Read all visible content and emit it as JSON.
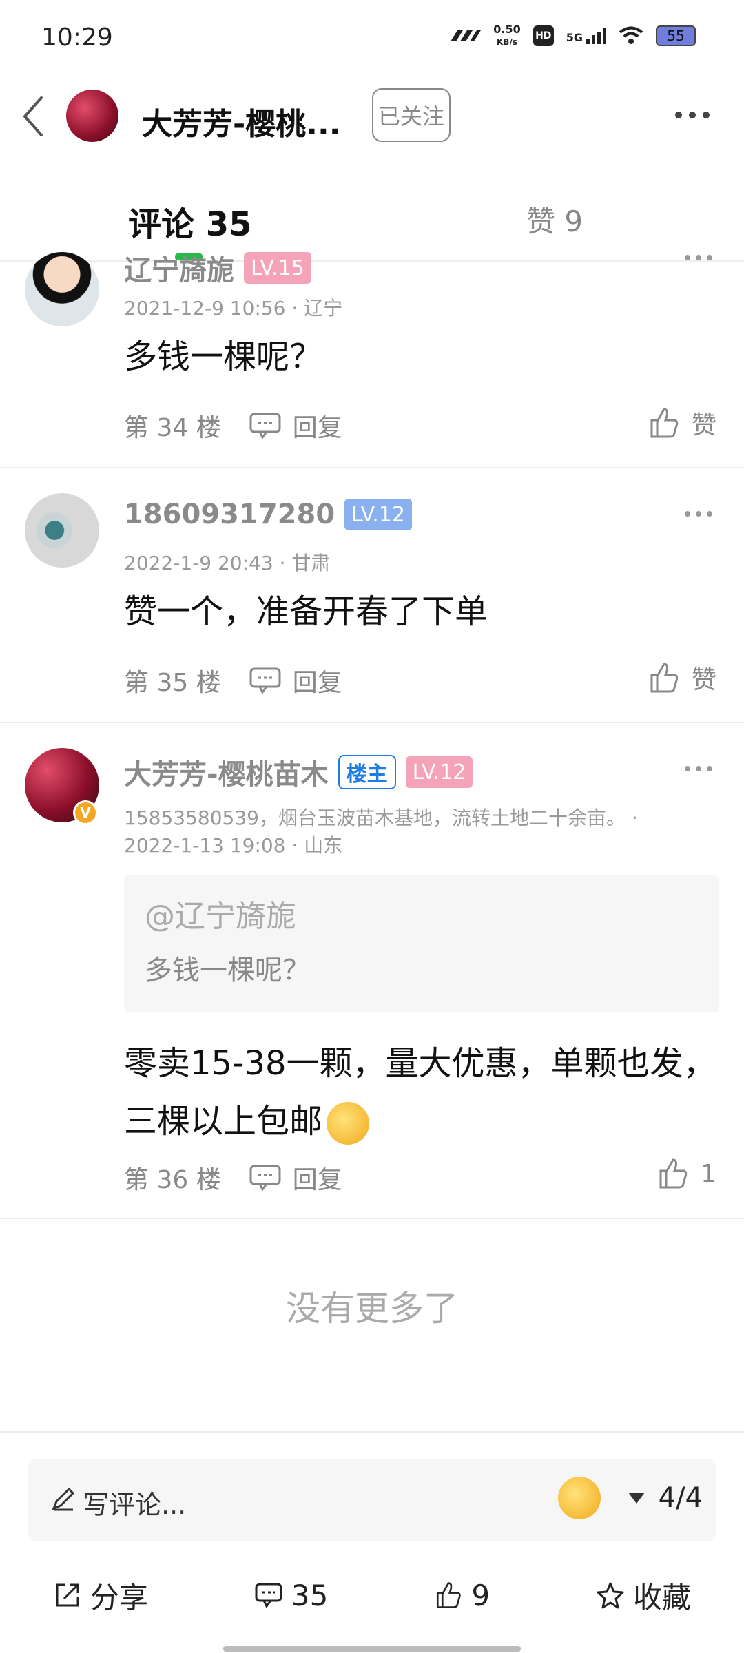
{
  "status_bar": {
    "time": "10:29",
    "net_speed_value": "0.50",
    "net_speed_unit": "KB/s",
    "hd": "HD",
    "network": "5G",
    "battery": "55"
  },
  "header": {
    "title": "大芳芳-樱桃...",
    "follow_label": "已关注"
  },
  "tabs": {
    "comments_label": "评论 35",
    "likes_label": "赞 9",
    "accent_color": "#2bb84a"
  },
  "comments": [
    {
      "user": "辽宁旖旎",
      "level": "LV.15",
      "meta": "2021-12-9 10:56 · 辽宁",
      "content": "多钱一棵呢？",
      "floor": "第 34 楼",
      "reply_label": "回复",
      "like_label": "赞"
    },
    {
      "user": "18609317280",
      "level": "LV.12",
      "meta": "2022-1-9 20:43 · 甘肃",
      "content": "赞一个，准备开春了下单",
      "floor": "第 35 楼",
      "reply_label": "回复",
      "like_label": "赞"
    },
    {
      "user": "大芳芳-樱桃苗木",
      "owner_badge": "楼主",
      "level": "LV.12",
      "verified": "V",
      "meta_line1": "15853580539，烟台玉波苗木基地，流转土地二十余亩。 ·",
      "meta_line2": "2022-1-13 19:08 · 山东",
      "quote_user": "@辽宁旖旎",
      "quote_text": "多钱一棵呢？",
      "content": "零卖15-38一颗，量大优惠，单颗也发，三棵以上包邮",
      "floor": "第 36 楼",
      "reply_label": "回复",
      "like_label": "1"
    }
  ],
  "no_more": "没有更多了",
  "input": {
    "placeholder": "写评论...",
    "page_indicator": "4/4"
  },
  "bottom_bar": {
    "share": "分享",
    "comments": "35",
    "likes": "9",
    "favorite": "收藏"
  }
}
